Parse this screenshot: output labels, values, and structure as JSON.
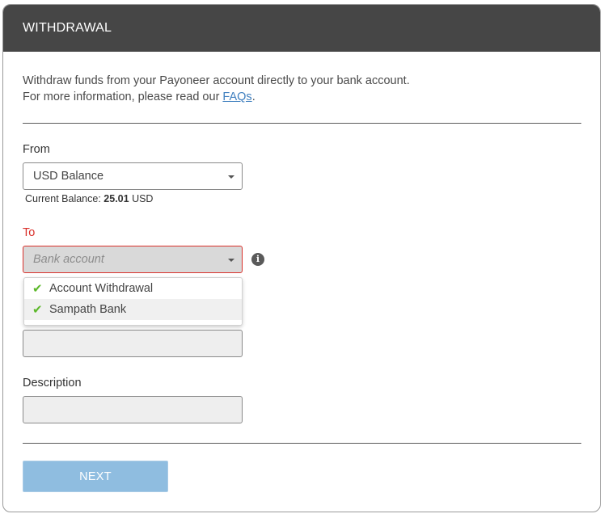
{
  "header": {
    "title": "WITHDRAWAL"
  },
  "intro": {
    "line1": "Withdraw funds from your Payoneer account directly to your bank account.",
    "line2_prefix": "For more information, please read our ",
    "faq_link": "FAQs",
    "line2_suffix": "."
  },
  "from": {
    "label": "From",
    "selected": "USD Balance",
    "balance_label": "Current Balance:",
    "balance_amount": "25.01",
    "balance_currency": "USD"
  },
  "to": {
    "label": "To",
    "placeholder": "Bank account",
    "options": [
      "Account Withdrawal",
      "Sampath Bank"
    ]
  },
  "amount": {
    "value": ""
  },
  "description": {
    "label": "Description",
    "value": ""
  },
  "next_button": {
    "label": "NEXT"
  },
  "colors": {
    "header_bg": "#464646",
    "error": "#d9302a",
    "link": "#3f7fbf",
    "check": "#5cb82a",
    "button": "#8fbde0"
  }
}
